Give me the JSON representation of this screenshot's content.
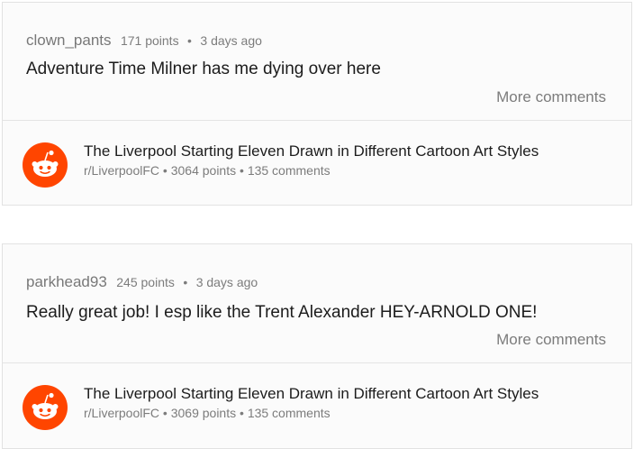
{
  "threads": [
    {
      "comment": {
        "author": "clown_pants",
        "points": "171 points",
        "separator": "•",
        "age": "3 days ago",
        "text": "Adventure Time Milner has me dying over here",
        "more_label": "More comments"
      },
      "post": {
        "title": "The Liverpool Starting Eleven Drawn in Different Cartoon Art Styles",
        "subreddit": "r/LiverpoolFC",
        "points": "3064 points",
        "comments": "135 comments",
        "separator": "•",
        "icon": "reddit-snoo-icon"
      }
    },
    {
      "comment": {
        "author": "parkhead93",
        "points": "245 points",
        "separator": "•",
        "age": "3 days ago",
        "text": "Really great job! I esp like the Trent Alexander HEY-ARNOLD ONE!",
        "more_label": "More comments"
      },
      "post": {
        "title": "The Liverpool Starting Eleven Drawn in Different Cartoon Art Styles",
        "subreddit": "r/LiverpoolFC",
        "points": "3069 points",
        "comments": "135 comments",
        "separator": "•",
        "icon": "reddit-snoo-icon"
      }
    }
  ],
  "colors": {
    "brand": "#ff4500",
    "text": "#1c1c1c",
    "muted": "#7c7c7c",
    "card_bg": "#fbfbfb",
    "border": "#e2e2e2"
  }
}
